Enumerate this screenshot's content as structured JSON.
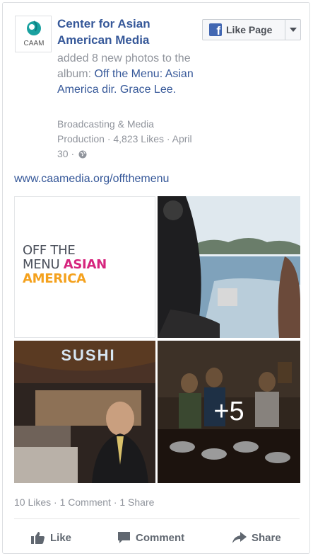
{
  "page": {
    "name": "Center for Asian American Media",
    "avatar_text": "CAAM"
  },
  "like_page_button": {
    "label": "Like Page"
  },
  "story": {
    "action": "added 8 new photos to the album:",
    "album": "Off the Menu: Asian America dir. Grace Lee."
  },
  "meta": {
    "text": "Broadcasting & Media Production · 4,823 Likes · April 30 ·"
  },
  "link": {
    "text": "www.caamedia.org/offthemenu"
  },
  "photos": {
    "tile1": {
      "line1": "OFF THE",
      "line2a": "MENU",
      "line2b": "ASIAN",
      "line3": "AMERICA"
    },
    "tile3": {
      "sign": "SUSHI"
    },
    "more_count": "+5"
  },
  "engagement": {
    "summary": "10 Likes · 1 Comment · 1 Share"
  },
  "actions": {
    "like": "Like",
    "comment": "Comment",
    "share": "Share"
  },
  "colors": {
    "link_blue": "#365899",
    "muted_gray": "#90949c",
    "facebook_blue": "#4267b2"
  }
}
